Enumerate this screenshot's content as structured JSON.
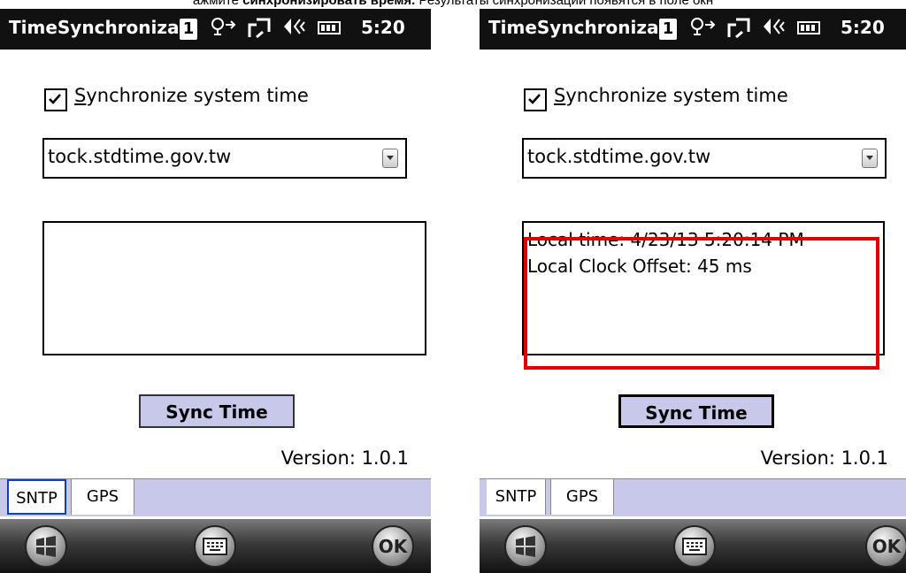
{
  "caption": {
    "prefix": "ажмите ",
    "bold": "синхронизировать время.",
    "suffix": " Результаты синхронизации появятся в поле окн"
  },
  "left_screen": {
    "title_bar": {
      "title": "TimeSynchroniza",
      "badge": "1",
      "connectivity_icon": "connectivity-icon",
      "signal_icon": "signal-icon",
      "volume_icon": "volume-icon",
      "battery_icon": "battery-icon",
      "time": "5:20"
    },
    "checkbox": {
      "checked": true,
      "label_first": "S",
      "label_rest": "ynchronize system time"
    },
    "server_combo": {
      "value": "tock.stdtime.gov.tw"
    },
    "result_lines": [],
    "sync_button": "Sync Time",
    "version": "Version: 1.0.1",
    "tabs": {
      "sntp": "SNTP",
      "gps": "GPS"
    },
    "soft_keys": {
      "start_icon": "windows-start-icon",
      "keyboard_icon": "keyboard-icon",
      "ok": "OK"
    }
  },
  "right_screen": {
    "title_bar": {
      "title": "TimeSynchroniza",
      "badge": "1",
      "connectivity_icon": "connectivity-icon",
      "signal_icon": "signal-icon",
      "volume_icon": "volume-icon",
      "battery_icon": "battery-icon",
      "time": "5:20"
    },
    "checkbox": {
      "checked": true,
      "label_first": "S",
      "label_rest": "ynchronize system time"
    },
    "server_combo": {
      "value": "tock.stdtime.gov.tw"
    },
    "result_lines": [
      "Local time: 4/23/13 5:20:14 PM",
      "Local Clock Offset: 45 ms"
    ],
    "sync_button": "Sync Time",
    "version": "Version: 1.0.1",
    "tabs": {
      "sntp": "SNTP",
      "gps": "GPS"
    },
    "soft_keys": {
      "start_icon": "windows-start-icon",
      "keyboard_icon": "keyboard-icon",
      "ok": "OK"
    },
    "highlight_color": "#e00000"
  }
}
